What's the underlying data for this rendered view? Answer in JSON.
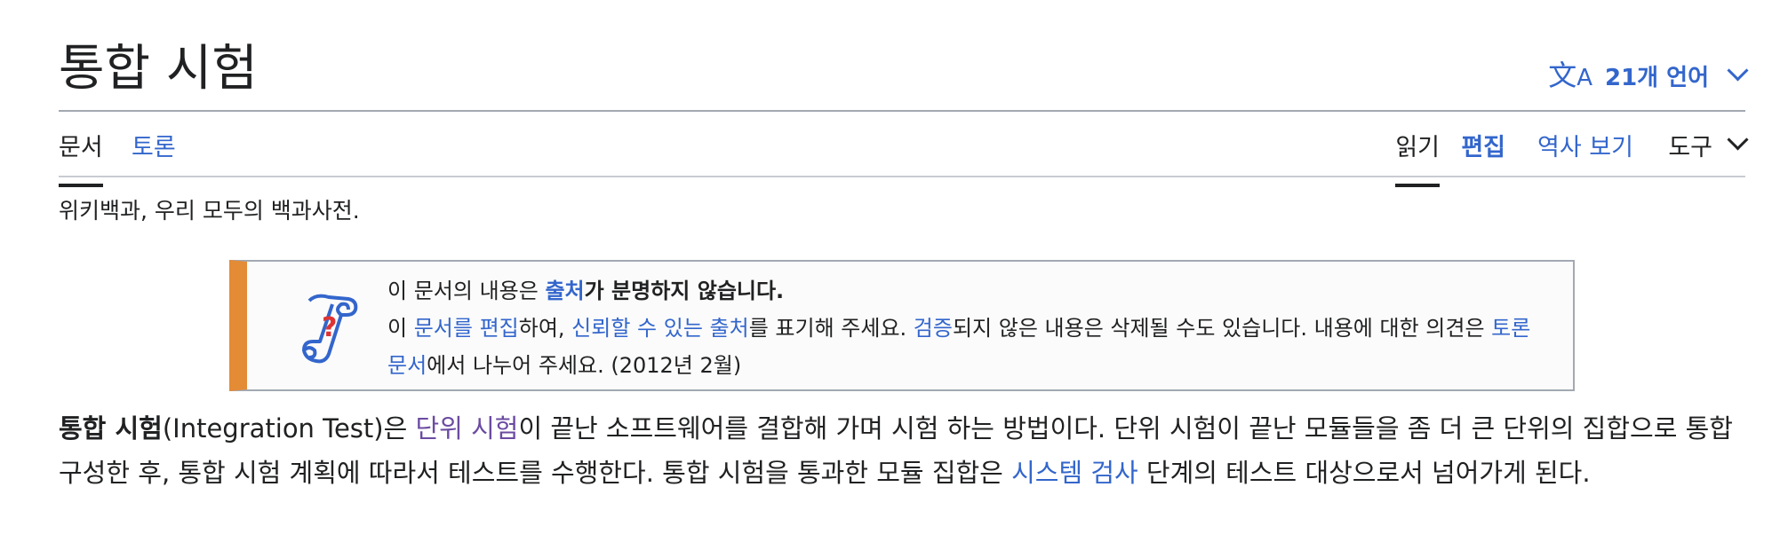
{
  "page": {
    "title": "통합 시험",
    "language_button": {
      "icon": "translate-icon",
      "label": "21개 언어"
    }
  },
  "tabs": {
    "left": [
      "문서",
      "토론"
    ],
    "read": "읽기",
    "edit": "편집",
    "history": "역사 보기",
    "tools": "도구"
  },
  "tagline": "위키백과, 우리 모두의 백과사전.",
  "notice": {
    "icon": "scroll-question-icon",
    "line1_pre": "이 문서의 내용은 ",
    "line1_link": "출처",
    "line1_post": "가 분명하지 않습니다.",
    "line2_a": "이 ",
    "line2_link1": "문서를 편집",
    "line2_b": "하여, ",
    "line2_link2": "신뢰할 수 있는 출처",
    "line2_c": "를 표기해 주세요. ",
    "line2_link3": "검증",
    "line2_d": "되지 않은 내용은 삭제될 수도 있습니다. 내용에 대한 의견은 ",
    "line2_link4": "토론 문서",
    "line2_e": "에서 나누어 주세요. (2012년 2월)"
  },
  "article": {
    "bold_term": "통합 시험",
    "seg1": "(Integration Test)은 ",
    "link1": "단위 시험",
    "seg2": "이 끝난 소프트웨어를 결합해 가며 시험 하는 방법이다. 단위 시험이 끝난 모듈들을 좀 더 큰 단위의 집합으로 통합 구성한 후, 통합 시험 계획에 따라서 테스트를 수행한다. 통합 시험을 통과한 모듈 집합은 ",
    "link2": "시스템 검사",
    "seg3": " 단계의 테스트 대상으로서 넘어가게 된다."
  },
  "colors": {
    "link": "#3366cc",
    "visited": "#6b4ba1",
    "notice_accent": "#e48b36",
    "border": "#a2a9b1"
  }
}
